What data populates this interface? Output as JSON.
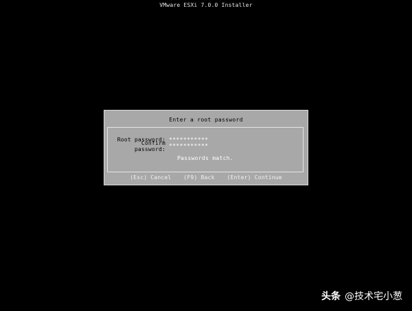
{
  "window": {
    "title": "VMware ESXi 7.0.0 Installer"
  },
  "dialog": {
    "title": "Enter a root password",
    "fields": [
      {
        "label": "Root password:",
        "value": "***********"
      },
      {
        "label": "Confirm password:",
        "value": "***********"
      }
    ],
    "status_message": "Passwords match.",
    "actions": {
      "cancel": "(Esc) Cancel",
      "back": "(F9) Back",
      "continue": "(Enter) Continue"
    }
  },
  "watermark": {
    "brand": "头条",
    "handle": "@技术宅小葱"
  },
  "colors": {
    "background": "#000000",
    "dialog_bg": "#a8a8a8",
    "dialog_border": "#dcdcdc",
    "label_text": "#000000",
    "value_text": "#ffffff"
  }
}
